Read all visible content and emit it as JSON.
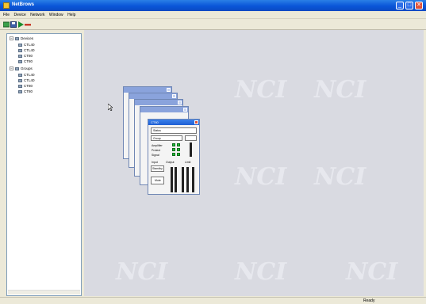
{
  "app": {
    "title": "NetBrows"
  },
  "menu": [
    "File",
    "Device",
    "Network",
    "Window",
    "Help"
  ],
  "window_buttons": {
    "minimize": "_",
    "maximize": "□",
    "close": "✕"
  },
  "toolbar": {
    "icons": [
      "connect-icon",
      "save-icon",
      "play-icon",
      "stop-icon"
    ]
  },
  "tree": {
    "groups": [
      {
        "label": "Devices",
        "expander": "−",
        "items": [
          "CTL40",
          "CTL40",
          "CT80",
          "CT80"
        ]
      },
      {
        "label": "Groups",
        "expander": "−",
        "items": [
          "CTL40",
          "CTL40",
          "CT80",
          "CT80"
        ]
      }
    ]
  },
  "workspace": {
    "watermark": "NCI"
  },
  "front_window": {
    "title": "CT80",
    "header": "Status",
    "group_label": "Group",
    "rows": [
      "Amplifier",
      "Protect",
      "Signal"
    ],
    "buttons": [
      "Standby",
      "Mute"
    ],
    "meters": [
      "Input",
      "Output",
      "Limit"
    ]
  },
  "status": {
    "text": "Ready"
  },
  "colors": {
    "titlebar": "#0a55d8",
    "workspace": "#d9dae1",
    "led": "#1fbf3a"
  }
}
